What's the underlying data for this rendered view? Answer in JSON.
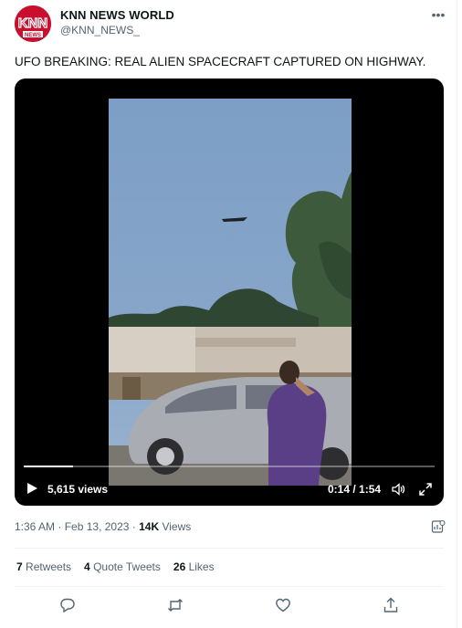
{
  "account": {
    "name": "KNN NEWS WORLD",
    "handle": "@KNN_NEWS_",
    "logo_text": "KNN",
    "logo_sub": "NEWS",
    "brand_color": "#c8102e"
  },
  "tweet": {
    "text": "UFO BREAKING: REAL ALIEN SPACECRAFT CAPTURED ON HIGHWAY."
  },
  "video": {
    "views": "5,615 views",
    "current_time": "0:14",
    "duration": "1:54",
    "time_separator": " / ",
    "progress_fraction": 0.12,
    "icons": [
      "play-icon",
      "volume-icon",
      "fullscreen-icon"
    ]
  },
  "meta": {
    "time": "1:36 AM",
    "dot1": " · ",
    "date": "Feb 13, 2023",
    "dot2": " · ",
    "views_count": "14K",
    "views_label": " Views"
  },
  "stats": {
    "retweets_count": "7",
    "retweets_label": " Retweets",
    "quotes_count": "4",
    "quotes_label": " Quote Tweets",
    "likes_count": "26",
    "likes_label": " Likes"
  },
  "actions": [
    "reply-icon",
    "retweet-icon",
    "like-icon",
    "share-icon"
  ],
  "colors": {
    "secondary_text": "#536471",
    "divider": "#eff3f4"
  }
}
